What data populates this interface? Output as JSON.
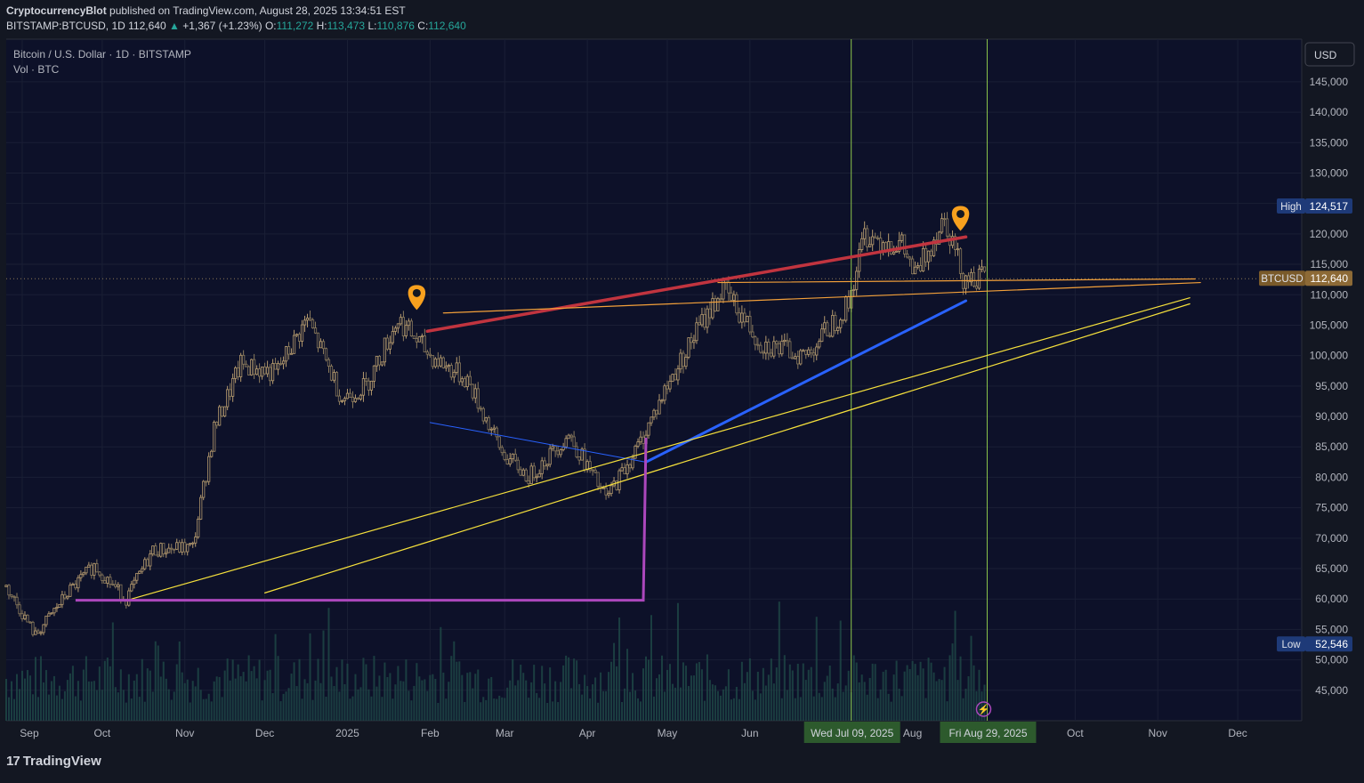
{
  "header": {
    "publisher": "CryptocurrencyBlot",
    "published_text": "published on TradingView.com, August 28, 2025 13:34:51 EST",
    "symbol_line_prefix": "BITSTAMP:BTCUSD, 1D",
    "last_price": "112,640",
    "change": "+1,367 (+1.23%)",
    "o_label": "O:",
    "o_value": "111,272",
    "h_label": "H:",
    "h_value": "113,473",
    "l_label": "L:",
    "l_value": "110,876",
    "c_label": "C:",
    "c_value": "112,640"
  },
  "legend": {
    "title": "Bitcoin / U.S. Dollar · 1D · BITSTAMP",
    "volume": "Vol · BTC"
  },
  "currency_button": "USD",
  "footer": {
    "brand": "TradingView",
    "icon": "tradingview-logo-icon"
  },
  "colors": {
    "background": "#0d1129",
    "candle": "#8a7a5c",
    "candle_dark": "#b59a6e",
    "red_line": "#c1343f",
    "blue_line": "#2962ff",
    "yellow_line": "#f5e03c",
    "orange_line": "#f3a03a",
    "purple_line": "#ab47bc",
    "vline": "#8bc34a",
    "marker": "#f7a01e",
    "volume": "#1f4a47"
  },
  "chart_data": {
    "type": "candlestick",
    "title": "Bitcoin / U.S. Dollar · 1D · BITSTAMP",
    "ylabel": "USD",
    "ylim": [
      40000,
      152000
    ],
    "y_ticks": [
      145000,
      140000,
      135000,
      130000,
      125000,
      120000,
      115000,
      110000,
      105000,
      100000,
      95000,
      90000,
      85000,
      80000,
      75000,
      70000,
      65000,
      60000,
      55000,
      50000,
      45000
    ],
    "y_tick_labels": [
      "145,000",
      "140,000",
      "135,000",
      "130,000",
      "125,000",
      "120,000",
      "115,000",
      "110,000",
      "105,000",
      "100,000",
      "95,000",
      "90,000",
      "85,000",
      "80,000",
      "75,000",
      "70,000",
      "65,000",
      "60,000",
      "55,000",
      "50,000",
      "45,000"
    ],
    "x_start": "2024-08-26",
    "x_end": "2025-12-25",
    "x_ticks": [
      {
        "date": "2024-09-01",
        "label": "Sep"
      },
      {
        "date": "2024-10-01",
        "label": "Oct"
      },
      {
        "date": "2024-11-01",
        "label": "Nov"
      },
      {
        "date": "2024-12-01",
        "label": "Dec"
      },
      {
        "date": "2025-01-01",
        "label": "2025"
      },
      {
        "date": "2025-02-01",
        "label": "Feb"
      },
      {
        "date": "2025-03-01",
        "label": "Mar"
      },
      {
        "date": "2025-04-01",
        "label": "Apr"
      },
      {
        "date": "2025-05-01",
        "label": "May"
      },
      {
        "date": "2025-06-01",
        "label": "Jun"
      },
      {
        "date": "2025-08-01",
        "label": "Aug"
      },
      {
        "date": "2025-10-01",
        "label": "Oct"
      },
      {
        "date": "2025-11-01",
        "label": "Nov"
      },
      {
        "date": "2025-12-01",
        "label": "Dec"
      }
    ],
    "highlighted_dates": [
      {
        "date": "2025-07-09",
        "label": "Wed Jul 09, 2025"
      },
      {
        "date": "2025-08-29",
        "label": "Fri Aug 29, 2025"
      }
    ],
    "price_labels": [
      {
        "name": "High",
        "value": 124517,
        "text": "124,517"
      },
      {
        "name": "BTCUSD",
        "value": 112640,
        "text": "112,640"
      },
      {
        "name": "Low",
        "value": 52546,
        "text": "52,546"
      }
    ],
    "close_path": [
      {
        "date": "2024-08-26",
        "close": 62000
      },
      {
        "date": "2024-09-06",
        "close": 54000
      },
      {
        "date": "2024-09-18",
        "close": 61000
      },
      {
        "date": "2024-09-28",
        "close": 65500
      },
      {
        "date": "2024-10-10",
        "close": 60000
      },
      {
        "date": "2024-10-20",
        "close": 68000
      },
      {
        "date": "2024-11-04",
        "close": 68500
      },
      {
        "date": "2024-11-12",
        "close": 88000
      },
      {
        "date": "2024-11-22",
        "close": 98500
      },
      {
        "date": "2024-12-05",
        "close": 97000
      },
      {
        "date": "2024-12-17",
        "close": 106000
      },
      {
        "date": "2024-12-30",
        "close": 93000
      },
      {
        "date": "2025-01-08",
        "close": 95000
      },
      {
        "date": "2025-01-20",
        "close": 106000
      },
      {
        "date": "2025-02-01",
        "close": 100000
      },
      {
        "date": "2025-02-15",
        "close": 96000
      },
      {
        "date": "2025-02-28",
        "close": 84000
      },
      {
        "date": "2025-03-10",
        "close": 80000
      },
      {
        "date": "2025-03-25",
        "close": 87000
      },
      {
        "date": "2025-04-08",
        "close": 76500
      },
      {
        "date": "2025-04-20",
        "close": 85000
      },
      {
        "date": "2025-05-01",
        "close": 95000
      },
      {
        "date": "2025-05-12",
        "close": 104000
      },
      {
        "date": "2025-05-22",
        "close": 111000
      },
      {
        "date": "2025-06-05",
        "close": 102000
      },
      {
        "date": "2025-06-22",
        "close": 100000
      },
      {
        "date": "2025-07-08",
        "close": 108500
      },
      {
        "date": "2025-07-14",
        "close": 120000
      },
      {
        "date": "2025-07-28",
        "close": 118000
      },
      {
        "date": "2025-08-02",
        "close": 113000
      },
      {
        "date": "2025-08-13",
        "close": 123000
      },
      {
        "date": "2025-08-20",
        "close": 113000
      },
      {
        "date": "2025-08-28",
        "close": 112640
      }
    ],
    "drawings": [
      {
        "name": "red-trendline",
        "from": {
          "date": "2025-01-31",
          "price": 104000
        },
        "to": {
          "date": "2025-08-21",
          "price": 119500
        }
      },
      {
        "name": "blue-trendline",
        "from": {
          "date": "2025-04-23",
          "price": 82500
        },
        "to": {
          "date": "2025-08-21",
          "price": 109000
        }
      },
      {
        "name": "thin-blue-line",
        "from": {
          "date": "2025-02-01",
          "price": 89000
        },
        "to": {
          "date": "2025-04-23",
          "price": 82500
        }
      },
      {
        "name": "orange-line-upper",
        "from": {
          "date": "2025-05-20",
          "price": 112000
        },
        "to": {
          "date": "2025-11-15",
          "price": 112600
        }
      },
      {
        "name": "orange-line-lower",
        "from": {
          "date": "2025-02-06",
          "price": 107000
        },
        "to": {
          "date": "2025-11-17",
          "price": 112000
        }
      },
      {
        "name": "yellow-line-upper",
        "from": {
          "date": "2024-10-12",
          "price": 60000
        },
        "to": {
          "date": "2025-11-13",
          "price": 109500
        }
      },
      {
        "name": "yellow-line-lower",
        "from": {
          "date": "2024-12-01",
          "price": 61000
        },
        "to": {
          "date": "2025-11-13",
          "price": 108500
        }
      },
      {
        "name": "purple-bracket",
        "points": [
          {
            "date": "2024-09-21",
            "price": 59800
          },
          {
            "date": "2025-04-22",
            "price": 59800
          },
          {
            "date": "2025-04-23",
            "price": 86500
          }
        ]
      }
    ],
    "markers": [
      {
        "name": "map-pin-icon",
        "date": "2025-01-27",
        "price": 107500
      },
      {
        "name": "map-pin-icon",
        "date": "2025-08-19",
        "price": 120500
      }
    ],
    "legend_position": "top-left",
    "grid": true
  }
}
